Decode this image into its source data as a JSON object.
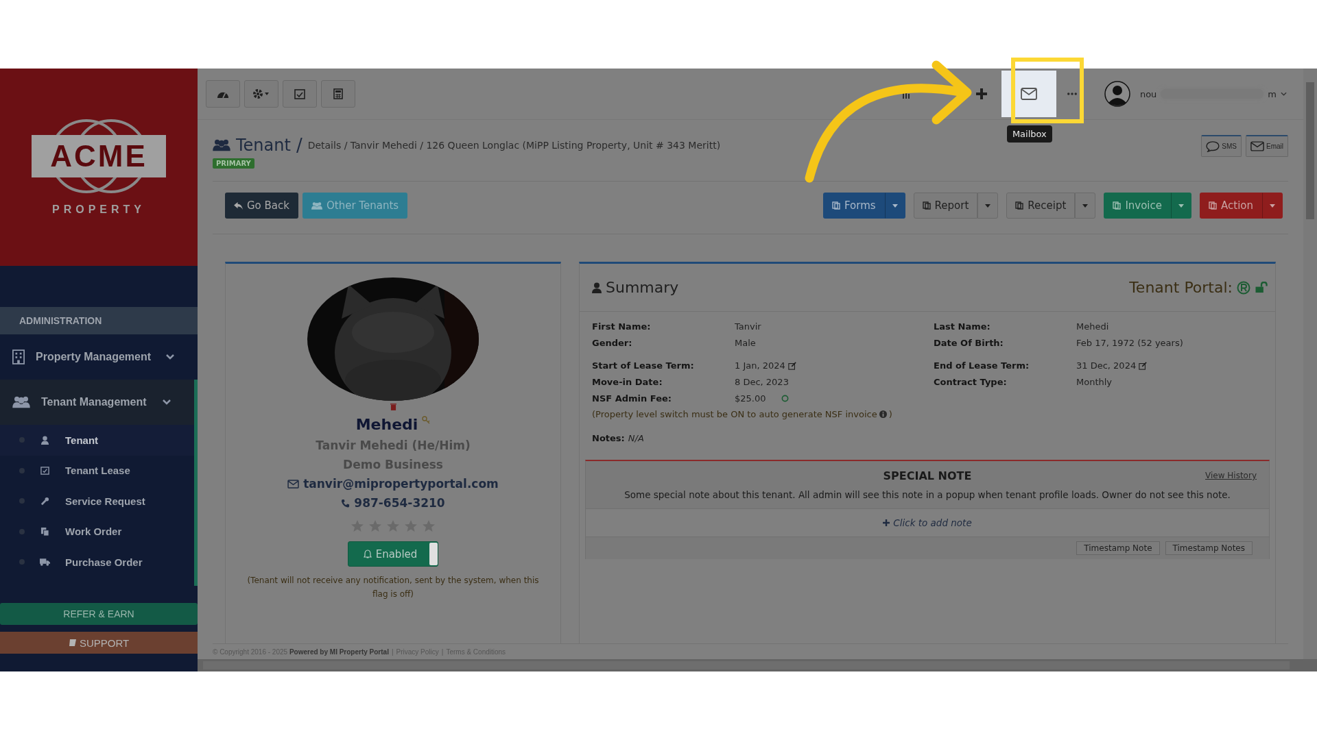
{
  "sidebar": {
    "logo": {
      "word": "ACME",
      "sub": "PROPERTY"
    },
    "section": "ADMINISTRATION",
    "items": [
      {
        "label": "Property Management",
        "selected": false
      },
      {
        "label": "Tenant Management",
        "selected": true,
        "children": [
          {
            "label": "Tenant",
            "selected": true
          },
          {
            "label": "Tenant Lease",
            "selected": false
          },
          {
            "label": "Service Request",
            "selected": false
          },
          {
            "label": "Work Order",
            "selected": false
          },
          {
            "label": "Purchase Order",
            "selected": false
          }
        ]
      }
    ],
    "refer": "REFER & EARN",
    "support": "SUPPORT"
  },
  "topbar": {
    "user_start": "nou",
    "user_end": "m",
    "tooltip": "Mailbox"
  },
  "header": {
    "title": "Tenant",
    "breadcrumb": "Details / Tanvir Mehedi / 126 Queen Longlac (MiPP Listing Property, Unit # 343 Meritt)",
    "badge": "PRIMARY",
    "separator": "/",
    "contact": [
      "SMS",
      "Email"
    ]
  },
  "left_buttons": [
    {
      "label": "Go Back",
      "kind": "dark"
    },
    {
      "label": "Other Tenants",
      "kind": "info"
    }
  ],
  "menus": [
    {
      "label": "Forms",
      "kind": "primary"
    },
    {
      "label": "Report",
      "kind": "default"
    },
    {
      "label": "Receipt",
      "kind": "default"
    },
    {
      "label": "Invoice",
      "kind": "success"
    },
    {
      "label": "Action",
      "kind": "danger"
    }
  ],
  "profile": {
    "name": "Mehedi",
    "full_name": "Tanvir Mehedi (He/Him)",
    "business": "Demo Business",
    "email": "tanvir@mipropertyportal.com",
    "phone": "987-654-3210",
    "stars": 0,
    "notify": {
      "on": true,
      "label": "Enabled"
    },
    "notice": "(Tenant will not receive any notification, sent by the system, when this flag is off)"
  },
  "summary": {
    "title": "Summary",
    "portal": "Tenant Portal:",
    "groups": [
      [
        {
          "label": "First Name:",
          "value": "Tanvir",
          "kind": "text"
        },
        {
          "label": "Last Name:",
          "value": "Mehedi",
          "kind": "text"
        },
        {
          "label": "Gender:",
          "value": "Male",
          "kind": "text"
        },
        {
          "label": "Date Of Birth:",
          "value": "Feb 17, 1972 (52 years)",
          "kind": "text"
        }
      ],
      [
        {
          "label": "Start of Lease Term:",
          "value": "1 Jan, 2024",
          "kind": "date"
        },
        {
          "label": "End of Lease Term:",
          "value": "31 Dec, 2024",
          "kind": "date"
        },
        {
          "label": "Move-in Date:",
          "value": "8 Dec, 2023",
          "kind": "text"
        },
        {
          "label": "Contract Type:",
          "value": "Monthly",
          "kind": "text"
        },
        {
          "label": "NSF Admin Fee:",
          "value": "$25.00",
          "kind": "fee"
        }
      ]
    ],
    "nsf_hint": "(Property level switch must be ON to auto generate NSF invoice",
    "nsf_hint_end": ")",
    "notes_label": "Notes:",
    "notes": "N/A"
  },
  "special_note": {
    "title": "SPECIAL NOTE",
    "history": "View History",
    "text": "Some special note about this tenant. All admin will see this note in a popup when tenant profile loads. Owner do not see this note.",
    "add": "Click to add note",
    "buttons": [
      "Timestamp Note",
      "Timestamp Notes"
    ]
  },
  "footer": {
    "copyright": "© Copyright 2016 - 2025 **Powered by MI Property Portal**",
    "links": [
      "Privacy Policy",
      "Terms & Conditions"
    ],
    "separator": "|"
  }
}
